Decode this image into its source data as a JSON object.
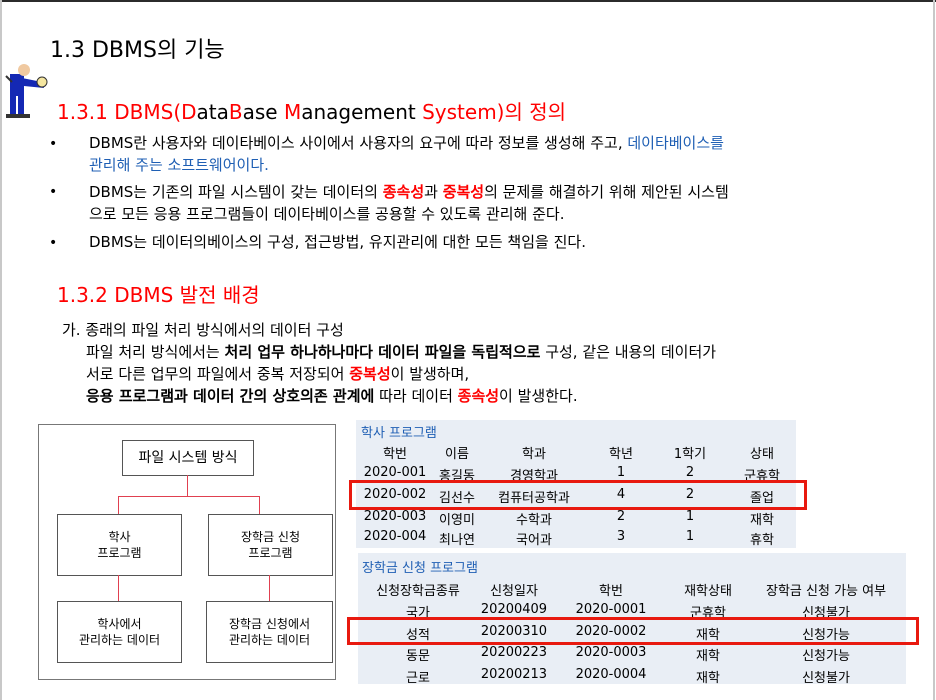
{
  "title": "1.3 DBMS의 기능",
  "section1": {
    "heading_parts": [
      "1.3.1 DBMS(",
      "D",
      "ata",
      "B",
      "ase ",
      "M",
      "anagement ",
      "S",
      "ystem)의 정의"
    ],
    "bullets": [
      {
        "l1": "DBMS란 사용자와 데이타베이스 사이에서 사용자의 요구에 따라 정보를 생성해 주고, ",
        "l1_blue": "데이타베이스를",
        "l2": "관리해 주는 소프트웨어이다."
      },
      {
        "l1_a": "DBMS는 기존의 파일 시스템이 갖는 데이터의 ",
        "l1_r1": "종속성",
        "l1_b": "과 ",
        "l1_r2": "중복성",
        "l1_c": "의 문제를 해결하기 위해 제안된 시스템",
        "l2": "으로 모든 응용 프로그램들이 데이타베이스를 공용할 수 있도록 관리해 준다."
      },
      {
        "l1": "DBMS는 데이터의베이스의 구성, 접근방법, 유지관리에 대한 모든 책임을 진다."
      }
    ],
    "bullet_symbol": "•"
  },
  "section2": {
    "heading": "1.3.2 DBMS 발전 배경",
    "p1": "가. 종래의 파일 처리 방식에서의 데이터 구성",
    "p2_a": "파일 처리 방식에서는 ",
    "p2_b": "처리 업무 하나하나마다 데이터 파일을 독립적으로",
    "p2_c": " 구성, 같은 내용의 데이터가",
    "p3_a": "서로 다른 업무의 파일에서 중복 저장되어 ",
    "p3_r": "중복성",
    "p3_b": "이 발생하며,",
    "p4_a": "응용 프로그램과 데이터 간의 상호의존 관계에",
    "p4_b": " 따라 데이터 ",
    "p4_r": "종속성",
    "p4_c": "이 발생한다."
  },
  "diagram": {
    "root": "파일 시스템 방식",
    "prog1": [
      "학사",
      "프로그램"
    ],
    "prog2": [
      "장학금 신청",
      "프로그램"
    ],
    "data1": [
      "학사에서",
      "관리하는 데이터"
    ],
    "data2": [
      "장학금 신청에서",
      "관리하는 데이터"
    ]
  },
  "table1": {
    "caption": "학사 프로그램",
    "headers": [
      "학번",
      "이름",
      "학과",
      "학년",
      "1학기",
      "상태"
    ],
    "rows": [
      [
        "2020-001",
        "홍길동",
        "경영학과",
        "1",
        "2",
        "군휴학"
      ],
      [
        "2020-002",
        "김선수",
        "컴퓨터공학과",
        "4",
        "2",
        "졸업"
      ],
      [
        "2020-003",
        "이영미",
        "수학과",
        "2",
        "1",
        "재학"
      ],
      [
        "2020-004",
        "최나연",
        "국어과",
        "3",
        "1",
        "휴학"
      ]
    ]
  },
  "table2": {
    "caption": "장학금 신청 프로그램",
    "headers": [
      "신청장학금종류",
      "신청일자",
      "학번",
      "재학상태",
      "장학금 신청 가능 여부"
    ],
    "rows": [
      [
        "국가",
        "20200409",
        "2020-0001",
        "군휴학",
        "신청불가"
      ],
      [
        "성적",
        "20200310",
        "2020-0002",
        "재학",
        "신청가능"
      ],
      [
        "동문",
        "20200223",
        "2020-0003",
        "재학",
        "신청가능"
      ],
      [
        "근로",
        "20200213",
        "2020-0004",
        "재학",
        "신청불가"
      ]
    ]
  }
}
